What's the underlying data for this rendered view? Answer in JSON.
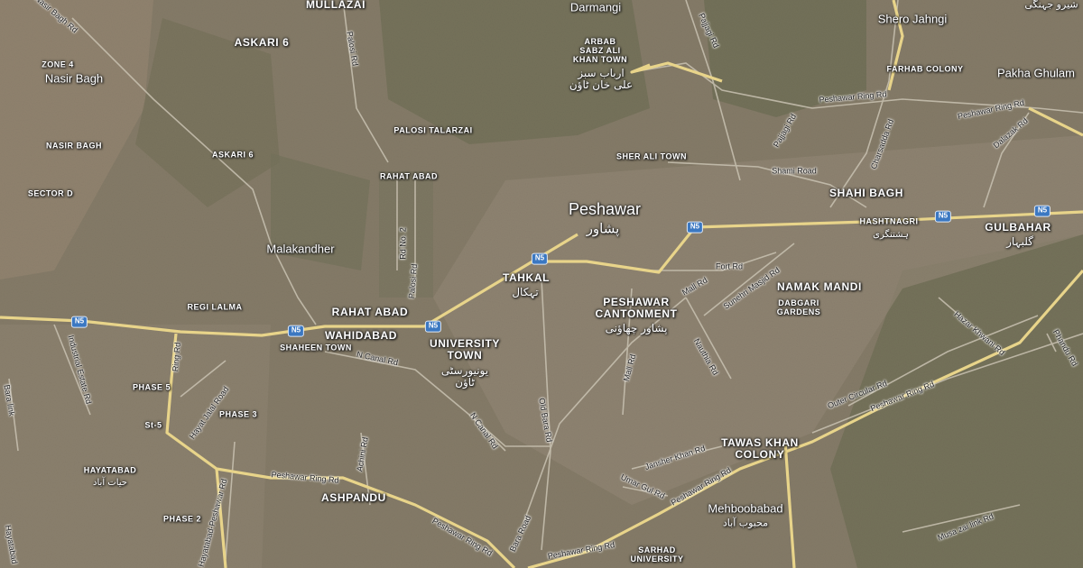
{
  "districts": {
    "mullazai": "MULLAZAI",
    "askari6_top": "ASKARI 6",
    "zone4": "ZONE 4",
    "nasir_bagh_caps": "NASIR BAGH",
    "askari6_mid": "ASKARI 6",
    "sector_d": "SECTOR D",
    "arbab": "ARBAB\nSABZ ALI\nKHAN TOWN",
    "palosi": "PALOSI TALARZAI",
    "sher_ali": "SHER ALI TOWN",
    "farhab": "FARHAB COLONY",
    "shahi_bagh": "SHAHI BAGH",
    "hashtnagri": "HASHTNAGRI",
    "gulbahar": "GULBAHAR",
    "rahat_abad_sm": "RAHAT ABAD",
    "rahat_abad": "RAHAT ABAD",
    "regi_lalma": "REGI LALMA",
    "wahidabad": "WAHIDABAD",
    "shaheen": "SHAHEEN TOWN",
    "university": "UNIVERSITY\nTOWN",
    "tahkal": "TAHKAL",
    "cantonment": "PESHAWAR\nCANTONMENT",
    "namak_mandi": "NAMAK MANDI",
    "dabgari": "DABGARI\nGARDENS",
    "phase5": "PHASE 5",
    "phase3": "PHASE 3",
    "st5": "St-5",
    "hayatabad": "HAYATABAD",
    "phase2": "PHASE 2",
    "ashpandu": "ASHPANDU",
    "tawas": "TAWAS KHAN\nCOLONY",
    "sarhad": "SARHAD\nUNIVERSITY"
  },
  "places": {
    "darmangi": "Darmangi",
    "nasir_bagh": "Nasir Bagh",
    "shero": "Shero Jahngi",
    "pakha": "Pakha Ghulam",
    "malakandher": "Malakandher",
    "mehboobabad": "Mehboobabad",
    "peshawar": "Peshawar"
  },
  "urdu": {
    "arbab": "ارباب سبز\nعلی خان ٹاؤن",
    "peshawar": "پشاور",
    "hashtnagri": "ہشتنگری",
    "gulbahar": "گلبہار",
    "tahkal": "تہکال",
    "cantonment": "پشاور چھاؤنی",
    "university": "یونیورسٹی\nٹاؤن",
    "mehboobabad": "محبوب آباد",
    "hayatabad": "حیات آباد",
    "shero": "شیرو جہنگی"
  },
  "roads": {
    "nasir_bagh_rd": "Nasir Bagh Rd",
    "palosi_rd": "Palosi Rd",
    "pajjagi_rd": "Pajjagi Rd",
    "pajjagi_rd2": "Pajjagi Rd",
    "charsadda_rd": "Charsadda Rd",
    "ring_rd_ne": "Peshawar Ring Rd",
    "ring_rd_ne2": "Peshawar Ring Rd",
    "dalazak_rd": "Dalazak Rd",
    "shami_rd": "Shami Road",
    "rd_no2": "Rd No. 2",
    "palosi_rd2": "Palosi Rd",
    "fort_rd": "Fort Rd",
    "mall_rd": "Mall Rd",
    "sunehri_rd": "Sunehri Masjid Rd",
    "n_canal_rd": "N Canal Rd",
    "n_canal_rd2": "N Canal Rd",
    "industrial_rd": "Industrial Estate Rd",
    "ring_rd_w": "Ring Rd",
    "bara_link": "Bara link",
    "hayat_jalal": "Hayat Jalal Road",
    "old_bara": "Old Bara Rd",
    "mall_rd2": "Mall Rd",
    "nauthia_rd": "Nauthia Rd",
    "achini_rd": "Achini Rd",
    "hazar_khwani": "Hazar Khwani Rd",
    "phandu_rd": "Phandu Rd",
    "outer_circular": "Outer Circular Rd",
    "ring_rd_e": "Peshawar Ring Rd",
    "jansher_rd": "Jansher Khan Rd",
    "ring_rd_sw": "Peshawar Ring Rd",
    "hayatabad_rd": "Hayatabad-Peshawar Rd",
    "umar_gul": "Umar Gul Rd",
    "ring_rd_s": "Peshawar Ring Rd",
    "ring_rd_s2": "Peshawar Ring Rd",
    "ring_rd_se": "Peshawar Ring Rd",
    "bara_road": "Bara Road",
    "musa_zai": "Musa zai link Rd",
    "hayatabad_l": "Hayatabad"
  },
  "shields": [
    "N5",
    "N5",
    "N5",
    "N5",
    "N5",
    "N5",
    "N5"
  ],
  "colors": {
    "terrain": "#7d7563",
    "vegetation": "#4f5a3b",
    "urban": "#9b8f80",
    "highway": "#e8d48a",
    "road": "#c9c2b2",
    "shield": "#3b78c2"
  }
}
